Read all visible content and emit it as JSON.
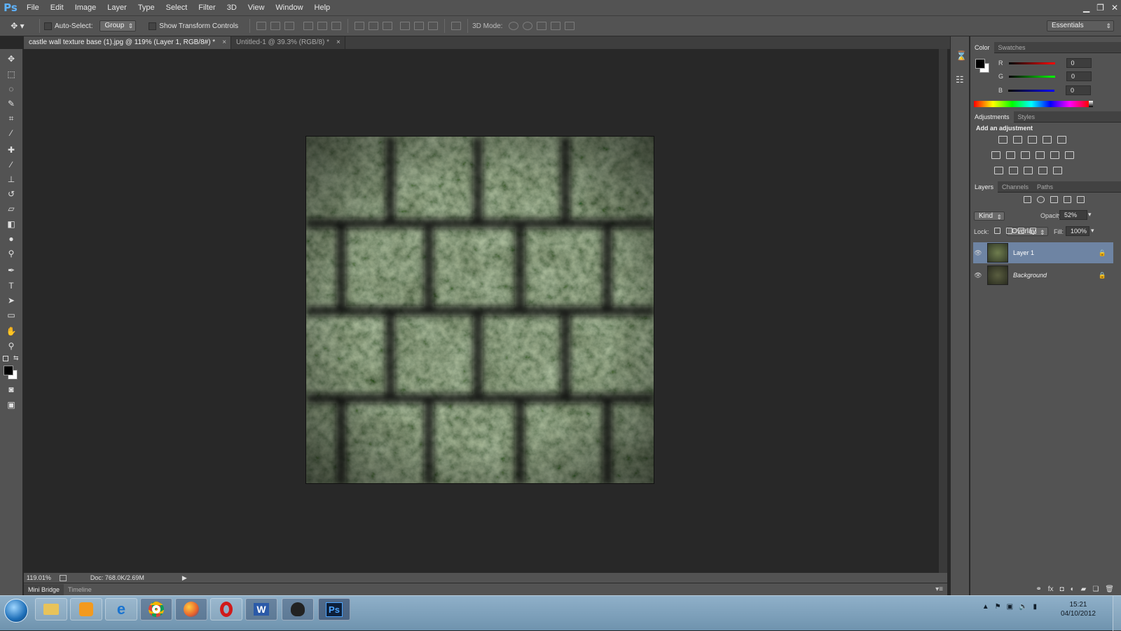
{
  "app": {
    "logo": "Ps"
  },
  "menu": [
    "File",
    "Edit",
    "Image",
    "Layer",
    "Type",
    "Select",
    "Filter",
    "3D",
    "View",
    "Window",
    "Help"
  ],
  "window_controls": {
    "minimize": "▁",
    "restore": "❐",
    "close": "✕"
  },
  "options_bar": {
    "auto_select_label": "Auto-Select:",
    "auto_select_value": "Group",
    "transform_label": "Show Transform Controls",
    "mode_3d_label": "3D Mode:",
    "workspace": "Essentials"
  },
  "tabs": [
    {
      "label": "castle wall texture base (1).jpg @ 119% (Layer 1, RGB/8#) *",
      "close": "×"
    },
    {
      "label": "Untitled-1 @ 39.3% (RGB/8) *",
      "close": "×"
    }
  ],
  "status": {
    "zoom": "119.01%",
    "doc": "Doc: 768.0K/2.69M",
    "arrow": "▶"
  },
  "bottom_tabs": [
    "Mini Bridge",
    "Timeline"
  ],
  "color_panel": {
    "tabs": [
      "Color",
      "Swatches"
    ],
    "channels": [
      {
        "name": "R",
        "value": "0",
        "color": "#d01010"
      },
      {
        "name": "G",
        "value": "0",
        "color": "#10b010"
      },
      {
        "name": "B",
        "value": "0",
        "color": "#1020d0"
      }
    ]
  },
  "adjustments_panel": {
    "tabs": [
      "Adjustments",
      "Styles"
    ],
    "title": "Add an adjustment"
  },
  "layers_panel": {
    "tabs": [
      "Layers",
      "Channels",
      "Paths"
    ],
    "filter_kind": "Kind",
    "blend_mode": "Overlay",
    "opacity_label": "Opacity:",
    "opacity_value": "52%",
    "lock_label": "Lock:",
    "fill_label": "Fill:",
    "fill_value": "100%",
    "layers": [
      {
        "name": "Layer 1",
        "selected": true
      },
      {
        "name": "Background",
        "selected": false
      }
    ],
    "footer_icons": [
      "link-icon",
      "fx-icon",
      "mask-icon",
      "adjustment-icon",
      "folder-icon",
      "new-layer-icon",
      "trash-icon"
    ]
  },
  "taskbar": {
    "apps": [
      "start-orb",
      "explorer-icon",
      "media-player-icon",
      "internet-explorer-icon",
      "chrome-icon",
      "firefox-icon",
      "opera-icon",
      "word-icon",
      "inkscape-icon",
      "photoshop-icon"
    ],
    "word_letter": "W",
    "ps_letter": "Ps",
    "time": "15:21",
    "date": "04/10/2012"
  }
}
